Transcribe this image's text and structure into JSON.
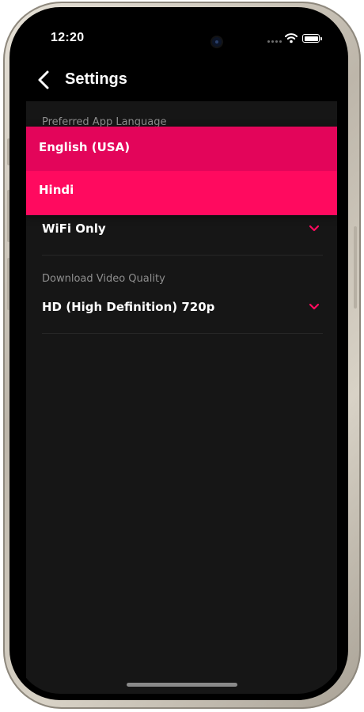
{
  "status_bar": {
    "time": "12:20"
  },
  "header": {
    "back_icon": "chevron-left-icon",
    "title": "Settings"
  },
  "settings": {
    "language": {
      "label": "Preferred App Language",
      "options": [
        "English (USA)",
        "Hindi"
      ],
      "selected_index": 0
    },
    "download_network": {
      "value": "WiFi Only"
    },
    "video_quality": {
      "label": "Download Video Quality",
      "value": "HD (High Definition) 720p"
    }
  },
  "colors": {
    "accent": "#ff0a5f",
    "accent_selected": "#e3055a",
    "panel_background": "#161616",
    "screen_background": "#000000"
  }
}
